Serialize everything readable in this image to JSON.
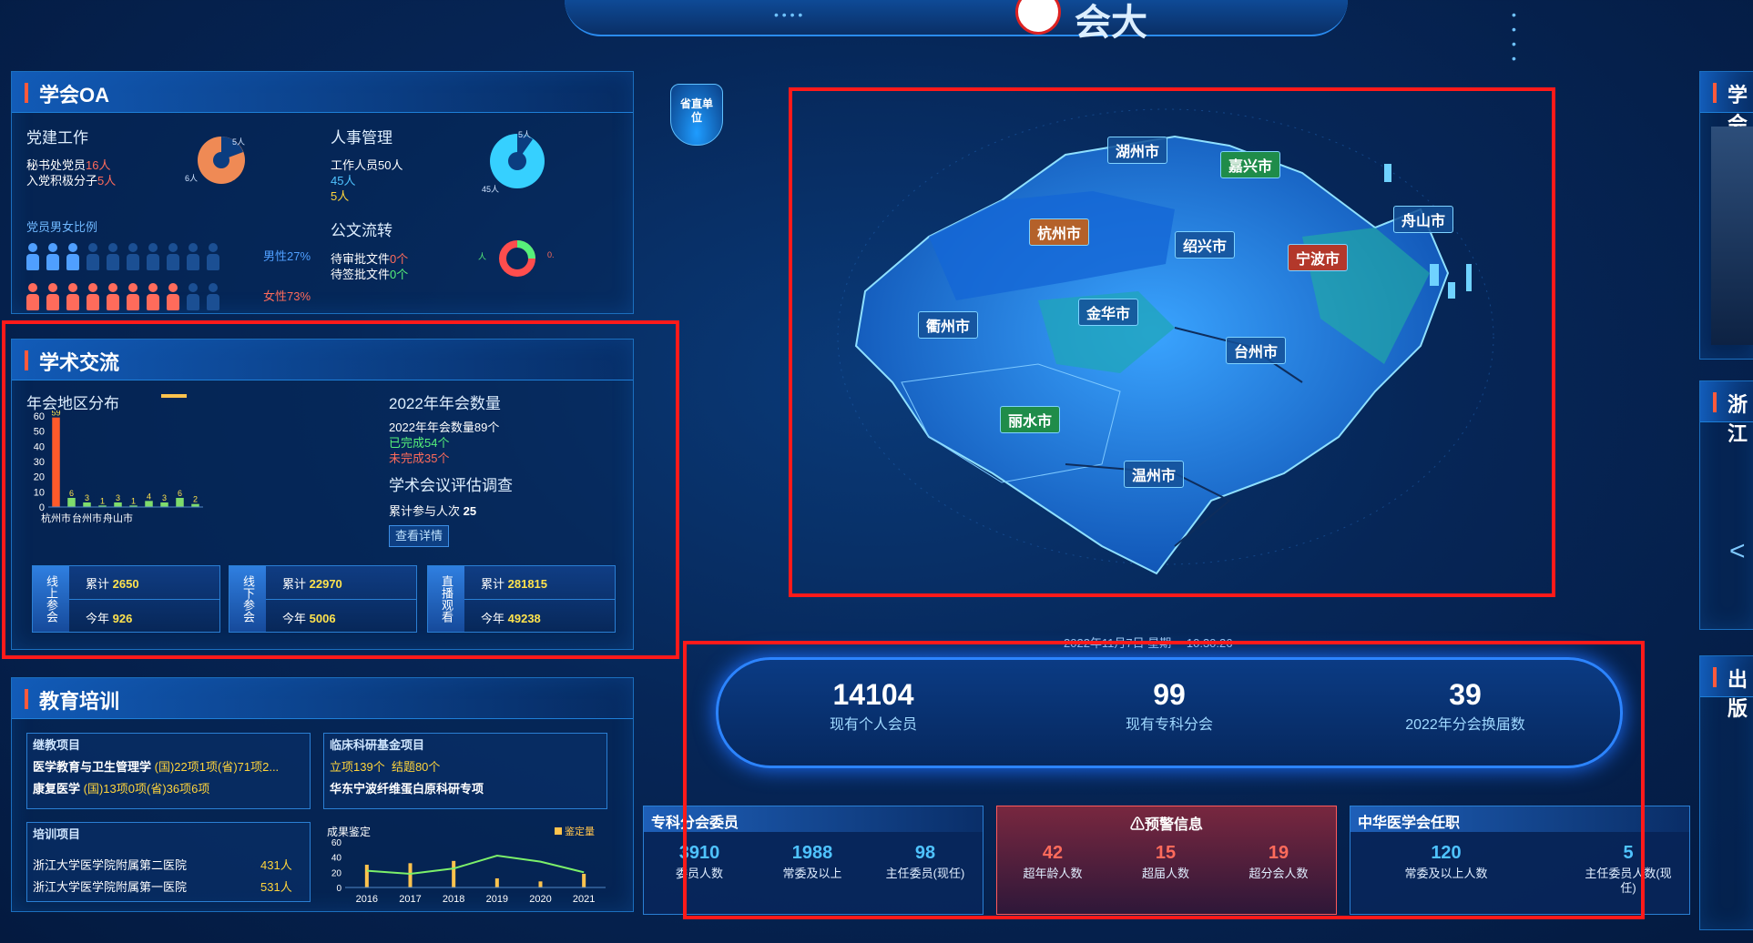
{
  "header": {
    "title_fragment": "会大"
  },
  "oa": {
    "title": "学会OA",
    "party": {
      "title": "党建工作",
      "line1_label": "秘书处党员",
      "line1_value": "16人",
      "line2_label": "入党积极分子",
      "line2_value": "5人",
      "pie_label_a": "5人",
      "pie_label_b": "6人"
    },
    "hr": {
      "title": "人事管理",
      "line1": "工作人员50人",
      "line2": "45人",
      "line3": "5人",
      "pie_label_a": "5人",
      "pie_label_b": "45人"
    },
    "gender": {
      "title": "党员男女比例",
      "male": "男性27%",
      "female": "女性73%"
    },
    "docs": {
      "title": "公文流转",
      "line1_label": "待审批文件",
      "line1_value": "0个",
      "line2_label": "待签批文件",
      "line2_value": "0个",
      "ring_left": "人",
      "ring_right": "0."
    }
  },
  "academic": {
    "title": "学术交流",
    "region": {
      "title": "年会地区分布"
    },
    "count": {
      "title": "2022年年会数量",
      "line1": "2022年年会数量89个",
      "line2": "已完成54个",
      "line3": "未完成35个"
    },
    "survey": {
      "title": "学术会议评估调查",
      "line_label": "累计参与人次",
      "line_value": "25",
      "button": "查看详情"
    },
    "cards": [
      {
        "tag": "线上参会",
        "total_label": "累计",
        "total": "2650",
        "year_label": "今年",
        "year": "926"
      },
      {
        "tag": "线下参会",
        "total_label": "累计",
        "total": "22970",
        "year_label": "今年",
        "year": "5006"
      },
      {
        "tag": "直播观看",
        "total_label": "累计",
        "total": "281815",
        "year_label": "今年",
        "year": "49238"
      }
    ]
  },
  "chart_data": [
    {
      "type": "bar",
      "title": "",
      "categories": [
        "杭州市",
        "",
        "台州市",
        "",
        "舟山市",
        "",
        "",
        "",
        "",
        ""
      ],
      "values": [
        59,
        6,
        3,
        1,
        3,
        1,
        4,
        3,
        6,
        2
      ],
      "ylim": [
        0,
        60
      ],
      "yticks": [
        0,
        10,
        20,
        30,
        40,
        50,
        60
      ],
      "bar_colors": [
        "#ff5a2a",
        "#7fdc6b",
        "#7fdc6b",
        "#7fdc6b",
        "#7fdc6b",
        "#7fdc6b",
        "#7fdc6b",
        "#7fdc6b",
        "#7fdc6b",
        "#7fdc6b"
      ]
    },
    {
      "type": "bar",
      "title": "成果鉴定",
      "categories": [
        "2016",
        "2017",
        "2018",
        "2019",
        "2020",
        "2021"
      ],
      "series": [
        {
          "name": "鉴定量",
          "values": [
            30,
            32,
            35,
            12,
            8,
            18
          ]
        }
      ],
      "line": [
        22,
        18,
        25,
        42,
        34,
        20
      ],
      "ylim": [
        0,
        60
      ],
      "yticks": [
        0,
        20,
        40,
        60
      ]
    }
  ],
  "education": {
    "title": "教育培训",
    "continuing": {
      "title": "继教项目",
      "row1_name": "医学教育与卫生管理学",
      "row1_value": "(国)22项1项(省)71项2...",
      "row2_name": "康复医学",
      "row2_value": "(国)13项0项(省)36项6项"
    },
    "clinical": {
      "title": "临床科研基金项目",
      "line1a": "立项139个",
      "line1b": "结题80个",
      "line2": "华东宁波纤维蛋白原科研专项"
    },
    "training": {
      "title": "培训项目",
      "rows": [
        {
          "name": "浙江大学医学院附属第二医院",
          "value": "431人"
        },
        {
          "name": "浙江大学医学院附属第一医院",
          "value": "531人"
        }
      ]
    }
  },
  "unit_button": "省直单位",
  "map": {
    "cities": [
      "湖州市",
      "嘉兴市",
      "杭州市",
      "绍兴市",
      "宁波市",
      "舟山市",
      "衢州市",
      "金华市",
      "台州市",
      "丽水市",
      "温州市"
    ]
  },
  "datetime": "2022年11月7日 星期一 10:30:26",
  "summary": [
    {
      "value": "14104",
      "label": "现有个人会员"
    },
    {
      "value": "99",
      "label": "现有专科分会"
    },
    {
      "value": "39",
      "label": "2022年分会换届数"
    }
  ],
  "committee": {
    "title": "专科分会委员",
    "items": [
      {
        "value": "3910",
        "label": "委员人数"
      },
      {
        "value": "1988",
        "label": "常委及以上"
      },
      {
        "value": "98",
        "label": "主任委员(现任)"
      }
    ]
  },
  "warning": {
    "title": "预警信息",
    "items": [
      {
        "value": "42",
        "label": "超年龄人数"
      },
      {
        "value": "15",
        "label": "超届人数"
      },
      {
        "value": "19",
        "label": "超分会人数"
      }
    ]
  },
  "cma": {
    "title": "中华医学会任职",
    "items": [
      {
        "value": "120",
        "label": "常委及以上人数"
      },
      {
        "value": "5",
        "label": "主任委员人数(现任)"
      }
    ]
  },
  "right": {
    "panel1": "学会",
    "panel2": "浙江",
    "panel3": "出版"
  },
  "colors": {
    "accent": "#1e7fd8",
    "warning": "#ff5a5a",
    "highlight": "#ffe34d",
    "alert_box": "#ff1a1a"
  }
}
